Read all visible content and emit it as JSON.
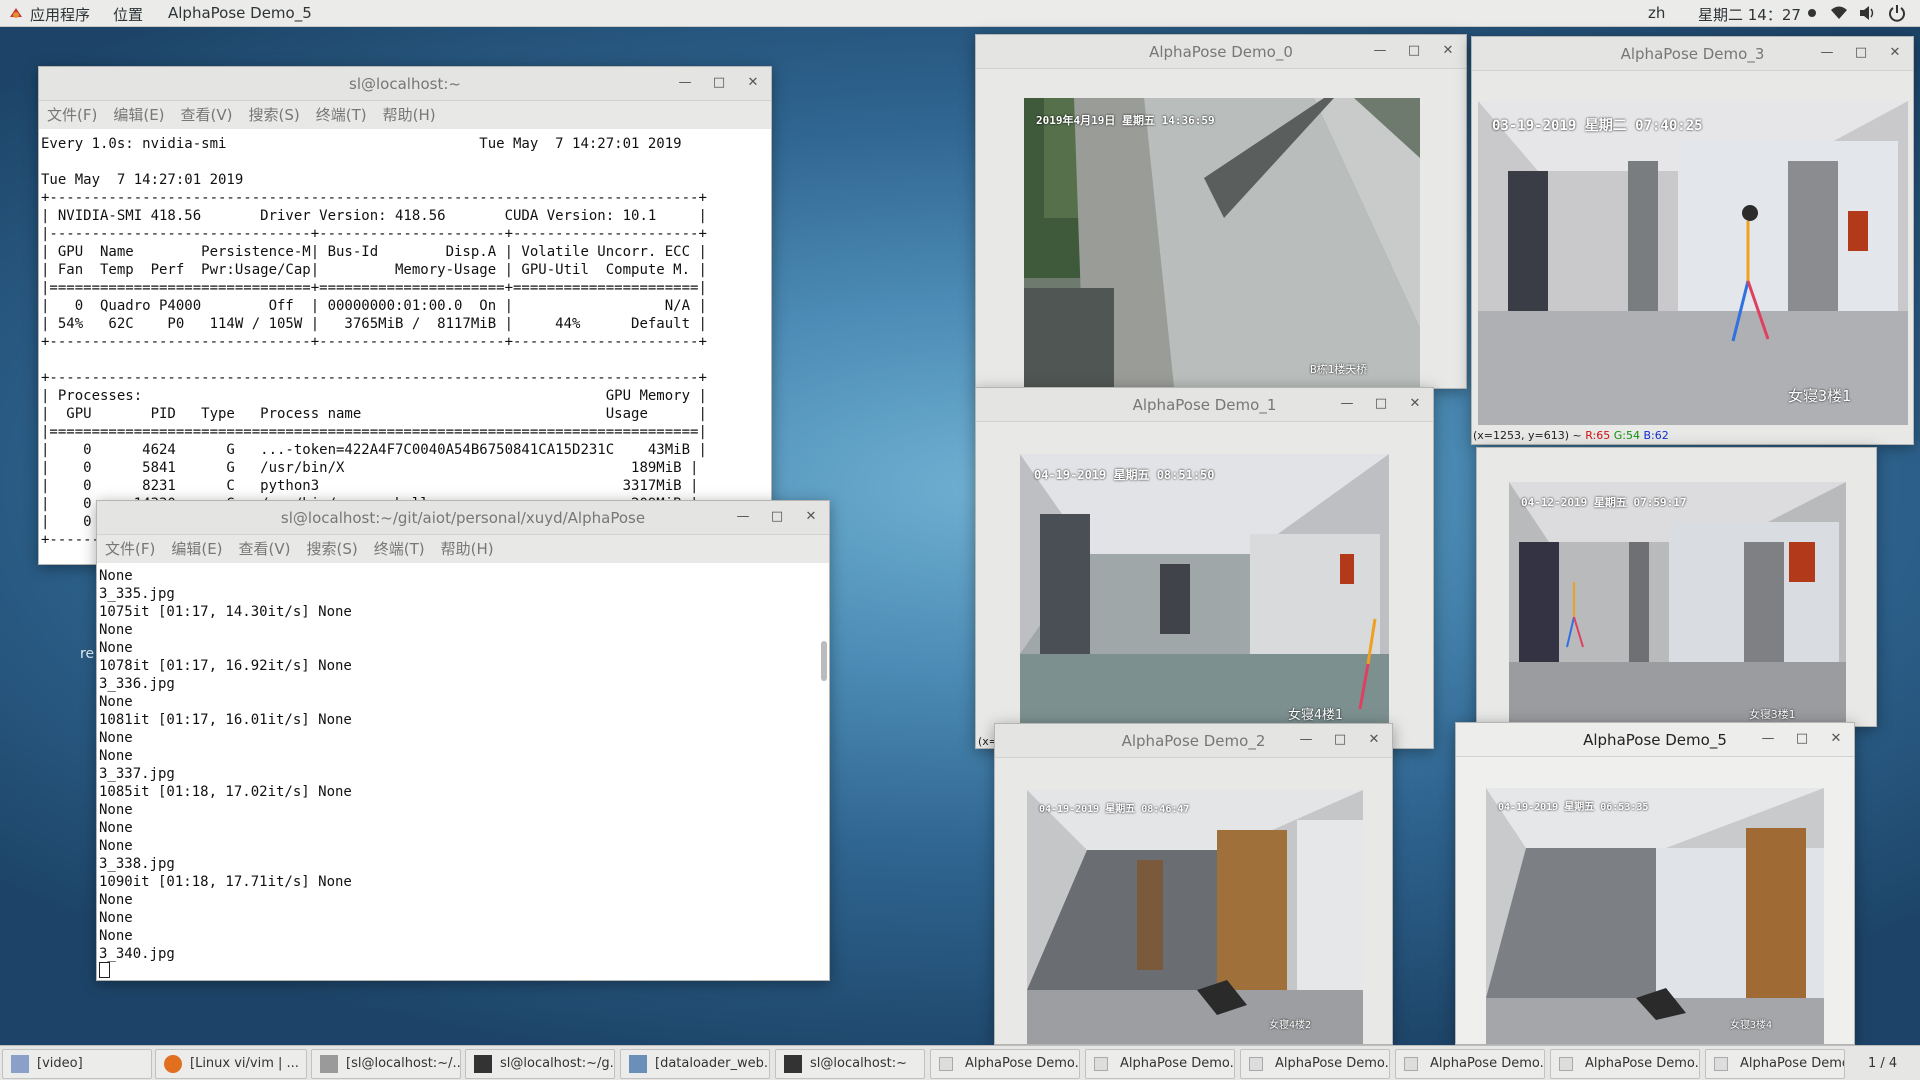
{
  "topbar": {
    "apps": "应用程序",
    "places": "位置",
    "active_window": "AlphaPose Demo_5",
    "lang": "zh",
    "clock": "星期二 14：27"
  },
  "nvidia_window": {
    "title": "sl@localhost:~",
    "menu": [
      "文件(F)",
      "编辑(E)",
      "查看(V)",
      "搜索(S)",
      "终端(T)",
      "帮助(H)"
    ],
    "lines": [
      "Every 1.0s: nvidia-smi                              Tue May  7 14:27:01 2019",
      "",
      "Tue May  7 14:27:01 2019",
      "+-----------------------------------------------------------------------------+",
      "| NVIDIA-SMI 418.56       Driver Version: 418.56       CUDA Version: 10.1     |",
      "|-------------------------------+----------------------+----------------------+",
      "| GPU  Name        Persistence-M| Bus-Id        Disp.A | Volatile Uncorr. ECC |",
      "| Fan  Temp  Perf  Pwr:Usage/Cap|         Memory-Usage | GPU-Util  Compute M. |",
      "|===============================+======================+======================|",
      "|   0  Quadro P4000        Off  | 00000000:01:00.0  On |                  N/A |",
      "| 54%   62C    P0   114W / 105W |   3765MiB /  8117MiB |     44%      Default |",
      "+-------------------------------+----------------------+----------------------+",
      "",
      "+-----------------------------------------------------------------------------+",
      "| Processes:                                                       GPU Memory |",
      "|  GPU       PID   Type   Process name                             Usage      |",
      "|=============================================================================|",
      "|    0      4624      G   ...-token=422A4F7C0040A54B6750841CA15D231C    43MiB |",
      "|    0      5841      G   /usr/bin/X                                  189MiB |",
      "|    0      8231      C   python3                                    3317MiB |",
      "|    0     14330      G   /usr/bin/gnome-shell                        209MiB |",
      "|    0                                                                      |",
      "+-----------------------------------------------------------------------------+"
    ]
  },
  "alpha_window": {
    "title": "sl@localhost:~/git/aiot/personal/xuyd/AlphaPose",
    "menu": [
      "文件(F)",
      "编辑(E)",
      "查看(V)",
      "搜索(S)",
      "终端(T)",
      "帮助(H)"
    ],
    "lines": [
      "None",
      "3_335.jpg",
      "1075it [01:17, 14.30it/s] None",
      "None",
      "None",
      "1078it [01:17, 16.92it/s] None",
      "3_336.jpg",
      "None",
      "1081it [01:17, 16.01it/s] None",
      "None",
      "None",
      "3_337.jpg",
      "1085it [01:18, 17.02it/s] None",
      "None",
      "None",
      "None",
      "3_338.jpg",
      "1090it [01:18, 17.71it/s] None",
      "None",
      "None",
      "None",
      "3_340.jpg"
    ]
  },
  "desktop_label": "re",
  "demo0": {
    "title": "AlphaPose Demo_0",
    "timestamp": "2019年4月19日  星期五  14:36:59",
    "caption": "B栋1楼天桥"
  },
  "demo3": {
    "title": "AlphaPose Demo_3",
    "timestamp": "03-19-2019 星期二 07:40:25",
    "caption": "女寝3楼1",
    "status": "(x=1253, y=613) ~",
    "status_r": "R:65",
    "status_g": "G:54",
    "status_b": "B:62"
  },
  "demo1": {
    "title": "AlphaPose Demo_1",
    "timestamp": "04-19-2019 星期五 08:51:50",
    "caption": "女寝4楼1",
    "status_stub": "(x="
  },
  "demo4": {
    "timestamp": "04-12-2019 星期五 07:59:17",
    "caption": "女寝3楼1"
  },
  "demo2": {
    "title": "AlphaPose Demo_2",
    "timestamp": "04-19-2019 星期五 08:46:47",
    "caption": "女寝4楼2"
  },
  "demo5": {
    "title": "AlphaPose Demo_5",
    "timestamp": "04-19-2019 星期五 06:53:35",
    "caption": "女寝3楼4"
  },
  "taskbar": {
    "items": [
      "[video]",
      "[Linux vi/vim | ...",
      "[sl@localhost:~/...",
      "sl@localhost:~/g...",
      "[dataloader_web...",
      "sl@localhost:~",
      "AlphaPose Demo...",
      "AlphaPose Demo...",
      "AlphaPose Demo...",
      "AlphaPose Demo...",
      "AlphaPose Demo...",
      "AlphaPose Demo..."
    ],
    "pager": "1 / 4"
  },
  "colors": {
    "status_r": "#d01010",
    "status_g": "#109010",
    "status_b": "#1030d0"
  }
}
